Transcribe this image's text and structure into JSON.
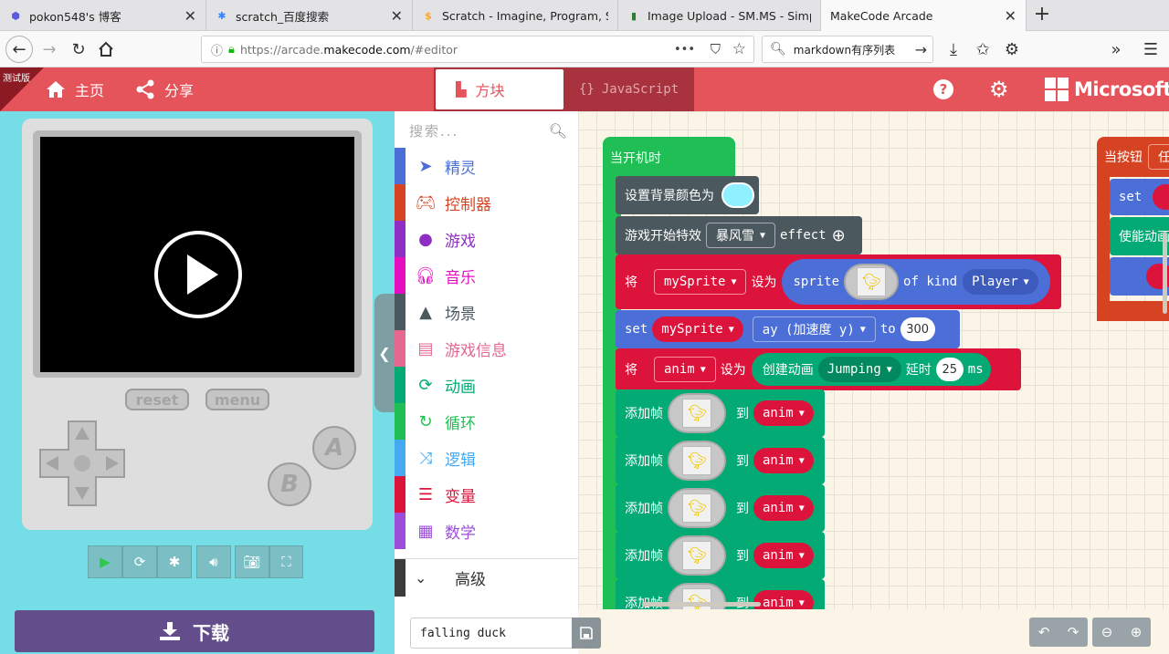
{
  "browser": {
    "tabs": [
      {
        "title": "pokon548's 博客",
        "icon": "blog-icon",
        "icon_color": "#5b5be0"
      },
      {
        "title": "scratch_百度搜索",
        "icon": "baidu-paw-icon",
        "icon_color": "#3385ff"
      },
      {
        "title": "Scratch - Imagine, Program, Sh",
        "icon": "scratch-icon",
        "icon_color": "#f9a825"
      },
      {
        "title": "Image Upload - SM.MS - Simple",
        "icon": "bar-chart-icon",
        "icon_color": "#2e7d32"
      },
      {
        "title": "MakeCode Arcade",
        "icon": "",
        "icon_color": ""
      }
    ],
    "url_prefix": "https://arcade.",
    "url_host": "makecode.com",
    "url_suffix": "/#editor",
    "search_text": "markdown有序列表"
  },
  "header": {
    "beta_label": "测试版",
    "home_label": "主页",
    "share_label": "分享",
    "blocks_label": "方块",
    "javascript_label": "JavaScript",
    "brand": "Microsoft",
    "color": "#e5535b"
  },
  "simulator": {
    "reset_label": "reset",
    "menu_label": "menu",
    "a_label": "A",
    "b_label": "B",
    "download_label": "下载"
  },
  "toolbox": {
    "search_placeholder": "搜索...",
    "categories": [
      {
        "label": "精灵",
        "color": "#4b6fd6",
        "icon": "paper-plane-icon"
      },
      {
        "label": "控制器",
        "color": "#d54322",
        "icon": "gamepad-icon"
      },
      {
        "label": "游戏",
        "color": "#8e2ec4",
        "icon": "circle-icon"
      },
      {
        "label": "音乐",
        "color": "#e30fc0",
        "icon": "headphones-icon"
      },
      {
        "label": "场景",
        "color": "#4b585e",
        "icon": "tree-icon"
      },
      {
        "label": "游戏信息",
        "color": "#e4688f",
        "icon": "id-card-icon"
      },
      {
        "label": "动画",
        "color": "#03aa74",
        "icon": "refresh-icon"
      },
      {
        "label": "循环",
        "color": "#20bf55",
        "icon": "loop-icon"
      },
      {
        "label": "逻辑",
        "color": "#45aaf2",
        "icon": "shuffle-icon"
      },
      {
        "label": "变量",
        "color": "#dc143c",
        "icon": "list-icon"
      },
      {
        "label": "数学",
        "color": "#9c4eda",
        "icon": "calculator-icon"
      }
    ],
    "advanced_label": "高级"
  },
  "workspace": {
    "on_start": "当开机时",
    "set_bg": "设置背景颜色为",
    "start_effect": "游戏开始特效",
    "effect_value": "暴风雪",
    "effect_word": "effect",
    "set_word_cn": "将",
    "sprite_var": "mySprite",
    "set_to_cn": "设为",
    "sprite_word": "sprite",
    "of_kind": "of kind",
    "kind_value": "Player",
    "set_word_en": "set",
    "ay_label": "ay (加速度 y)",
    "to_word": "to",
    "ay_value": "300",
    "anim_var": "anim",
    "create_anim": "创建动画",
    "anim_type": "Jumping",
    "delay_label": "延时",
    "delay_value": "25",
    "ms_label": "ms",
    "add_frame": "添加帧",
    "to_cn": "到",
    "on_button": "当按钮",
    "on_button_value": "任",
    "set_side": "set",
    "enable_anim": "使能动画"
  },
  "project": {
    "name": "falling duck"
  }
}
